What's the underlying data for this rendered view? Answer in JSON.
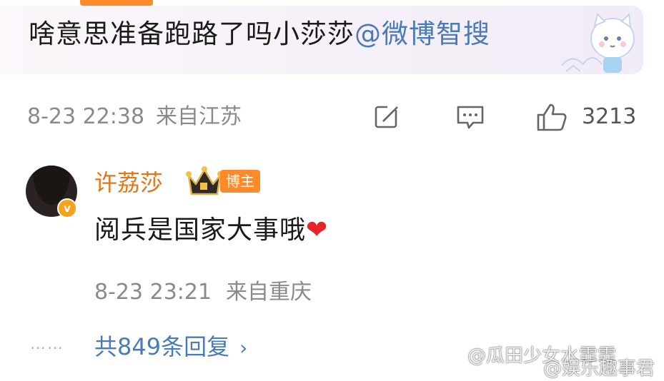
{
  "post": {
    "text": "啥意思准备跑路了吗小莎莎",
    "mention": "@微博智搜",
    "time": "8-23 22:38",
    "location": "来自江苏",
    "like_count": "3213",
    "icons": [
      "edit-icon",
      "comment-icon",
      "like-icon"
    ]
  },
  "reply": {
    "author": "许荔莎",
    "badge": "博主",
    "text": "阅兵是国家大事哦",
    "emoji": "❤",
    "time": "8-23 23:21",
    "location": "来自重庆",
    "dots": "……",
    "more_replies": "共849条回复",
    "chevron": "›"
  },
  "watermarks": [
    "@瓜田少女水霏霏",
    "@娱乐趣事君"
  ],
  "colors": {
    "link": "#4a7bb8",
    "author": "#e2761a",
    "badge": "#ff8a2a",
    "heart": "#e8242b"
  }
}
